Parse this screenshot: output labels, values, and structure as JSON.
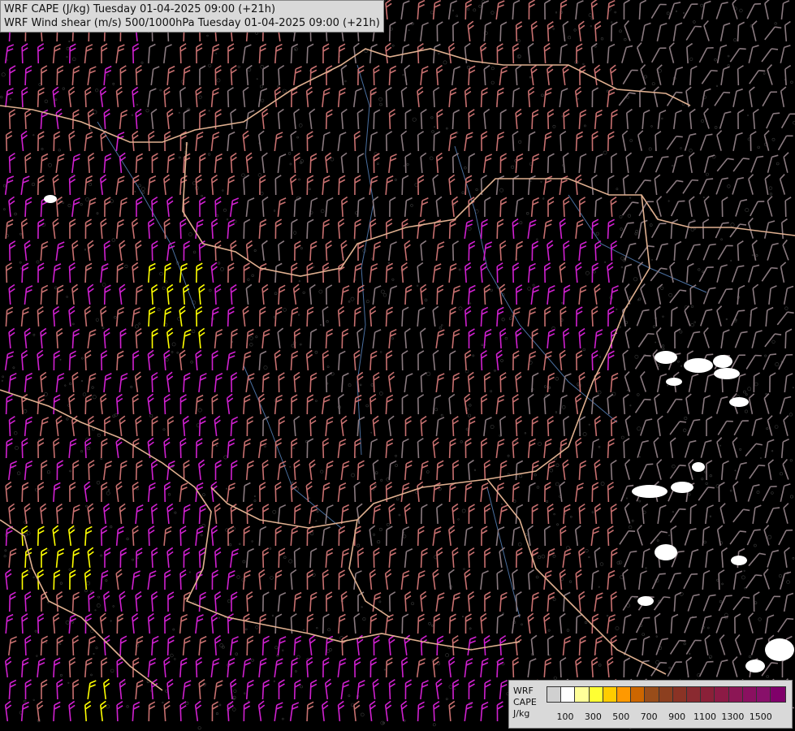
{
  "header": {
    "line1": "WRF CAPE (J/kg) Tuesday 01-04-2025 09:00 (+21h)",
    "line2": "WRF Wind shear (m/s) 500/1000hPa Tuesday 01-04-2025 09:00 (+21h)"
  },
  "legend": {
    "label_lines": [
      "WRF",
      "CAPE",
      "J/kg"
    ],
    "swatches": [
      "#d0d0d0",
      "#ffffff",
      "#ffff99",
      "#ffff33",
      "#ffcc00",
      "#ff9900",
      "#cc6600",
      "#994d1a",
      "#8c3f1f",
      "#8a3325",
      "#8a2a30",
      "#8a2038",
      "#8c1a45",
      "#8c1655",
      "#8a1060",
      "#88106a",
      "#80006a"
    ],
    "ticks": [
      "100",
      "300",
      "500",
      "700",
      "900",
      "1100",
      "1300",
      "1500"
    ]
  },
  "colors": {
    "background": "#000000",
    "barb_strong": "#d020d0",
    "barb_mid": "#c87070",
    "barb_weak": "#8a7a80",
    "barb_yellow": "#ffff00",
    "border": "#e0b090",
    "river": "#4a6fa0",
    "cape_patch": "#ffffff"
  }
}
